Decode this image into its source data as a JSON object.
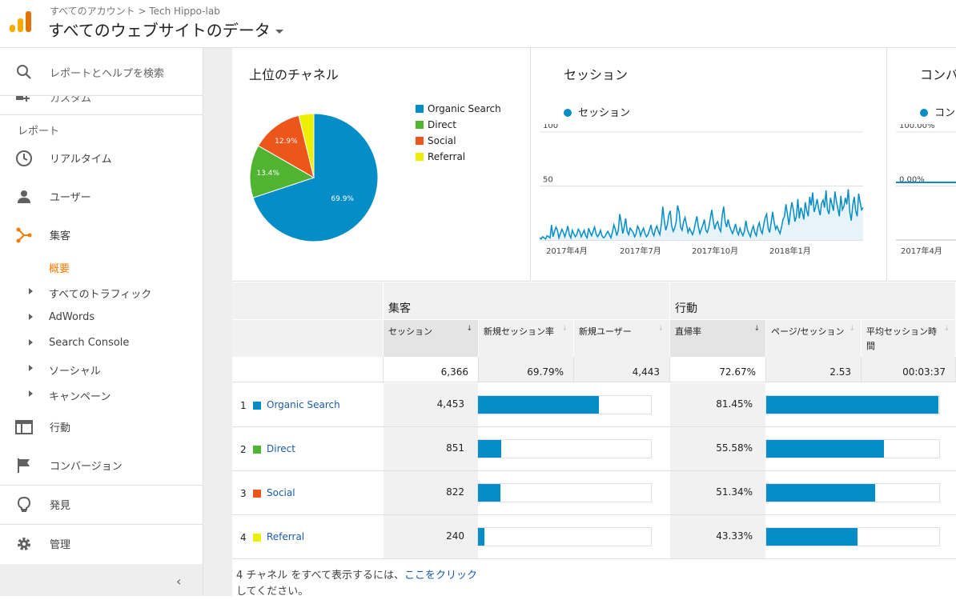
{
  "header": {
    "breadcrumb": "すべてのアカウント > Tech Hippo-lab",
    "property_title": "すべてのウェブサイトのデータ"
  },
  "sidebar": {
    "search_label": "レポートとヘルプを検索",
    "custom_label": "カスタム",
    "section_label": "レポート",
    "items": [
      {
        "label": "リアルタイム",
        "icon": "clock-icon"
      },
      {
        "label": "ユーザー",
        "icon": "person-icon"
      },
      {
        "label": "集客",
        "icon": "acquisition-icon"
      }
    ],
    "acquisition_active_sub": "概要",
    "acquisition_subs": [
      "すべてのトラフィック",
      "AdWords",
      "Search Console",
      "ソーシャル",
      "キャンペーン"
    ],
    "behavior_label": "行動",
    "conversion_label": "コンバージョン",
    "discover_label": "発見",
    "admin_label": "管理",
    "collapse_glyph": "‹"
  },
  "panels": {
    "channels_title": "上位のチャネル",
    "sessions_title": "セッション",
    "sessions_legend": "セッション",
    "conversion_title": "コンバ",
    "conversion_legend": "コン"
  },
  "chart_data": [
    {
      "type": "pie",
      "title": "上位のチャネル",
      "categories": [
        "Organic Search",
        "Direct",
        "Social",
        "Referral"
      ],
      "values": [
        69.9,
        13.4,
        12.9,
        3.8
      ],
      "slice_labels": [
        "69.9%",
        "13.4%",
        "12.9%",
        ""
      ],
      "colors": [
        "#058dc7",
        "#50b432",
        "#ed561b",
        "#edef00"
      ],
      "legend_position": "right"
    },
    {
      "type": "area",
      "title": "セッション",
      "series_name": "セッション",
      "yticks": [
        "100",
        "50"
      ],
      "ylim": [
        0,
        100
      ],
      "xticks": [
        "2017年4月",
        "2017年7月",
        "2017年10月",
        "2018年1月"
      ],
      "color": "#058dc7",
      "values": [
        2,
        1,
        3,
        2,
        1,
        4,
        3,
        2,
        14,
        3,
        8,
        12,
        9,
        2,
        6,
        10,
        7,
        3,
        8,
        13,
        5,
        2,
        9,
        6,
        3,
        5,
        10,
        8,
        3,
        6,
        9,
        4,
        2,
        11,
        7,
        4,
        8,
        12,
        6,
        3,
        5,
        9,
        4,
        2,
        3,
        6,
        8,
        5,
        2,
        7,
        14,
        10,
        4,
        9,
        24,
        16,
        6,
        12,
        20,
        8,
        5,
        11,
        9,
        7,
        3,
        6,
        13,
        10,
        4,
        8,
        11,
        6,
        3,
        5,
        9,
        14,
        7,
        4,
        10,
        13,
        8,
        5,
        15,
        31,
        18,
        9,
        14,
        23,
        27,
        13,
        8,
        11,
        17,
        32,
        26,
        12,
        9,
        17,
        21,
        14,
        7,
        11,
        8,
        5,
        9,
        16,
        22,
        12,
        6,
        10,
        14,
        19,
        9,
        7,
        12,
        20,
        28,
        18,
        10,
        15,
        17,
        11,
        8,
        22,
        31,
        17,
        12,
        19,
        13,
        9,
        6,
        10,
        15,
        8,
        5,
        11,
        7,
        4,
        8,
        18,
        10,
        6,
        3,
        9,
        13,
        7,
        4,
        12,
        16,
        9,
        6,
        14,
        21,
        24,
        11,
        7,
        16,
        26,
        17,
        10,
        13,
        9,
        6,
        12,
        19,
        22,
        33,
        24,
        14,
        26,
        35,
        28,
        17,
        22,
        38,
        20,
        30,
        26,
        19,
        35,
        27,
        22,
        40,
        32,
        44,
        26,
        31,
        38,
        29,
        23,
        34,
        37,
        30,
        46,
        28,
        24,
        39,
        33,
        27,
        45,
        36,
        29,
        22,
        41,
        28,
        31,
        39,
        33,
        47,
        26,
        18,
        32,
        40,
        27,
        22,
        43,
        35,
        28,
        30
      ]
    },
    {
      "type": "line",
      "title": "コンバ",
      "yticks": [
        "100.00%",
        "0.00%"
      ],
      "xticks": [
        "2017年4月"
      ],
      "values": [
        0,
        0
      ]
    }
  ],
  "table": {
    "group_acquisition": "集客",
    "group_behavior": "行動",
    "columns": [
      "セッション",
      "新規セッション率",
      "新規ユーザー",
      "直帰率",
      "ページ/セッション",
      "平均セッション時間"
    ],
    "sort_glyph": "↓",
    "totals": {
      "sessions": "6,366",
      "new_session_rate": "69.79%",
      "new_users": "4,443",
      "bounce_rate": "72.67%",
      "pages_per_session": "2.53",
      "avg_duration": "00:03:37"
    },
    "rows": [
      {
        "rank": "1",
        "name": "Organic Search",
        "color": "#058dc7",
        "sessions": "4,453",
        "sessions_value": 4453,
        "bounce": "81.45%",
        "bounce_value": 81.45
      },
      {
        "rank": "2",
        "name": "Direct",
        "color": "#50b432",
        "sessions": "851",
        "sessions_value": 851,
        "bounce": "55.58%",
        "bounce_value": 55.58
      },
      {
        "rank": "3",
        "name": "Social",
        "color": "#ed561b",
        "sessions": "822",
        "sessions_value": 822,
        "bounce": "51.34%",
        "bounce_value": 51.34
      },
      {
        "rank": "4",
        "name": "Referral",
        "color": "#edef00",
        "sessions": "240",
        "sessions_value": 240,
        "bounce": "43.33%",
        "bounce_value": 43.33
      }
    ]
  },
  "footnote": {
    "prefix": "4 チャネル をすべて表示するには、",
    "link": "ここをクリック",
    "suffix": "してください。"
  }
}
